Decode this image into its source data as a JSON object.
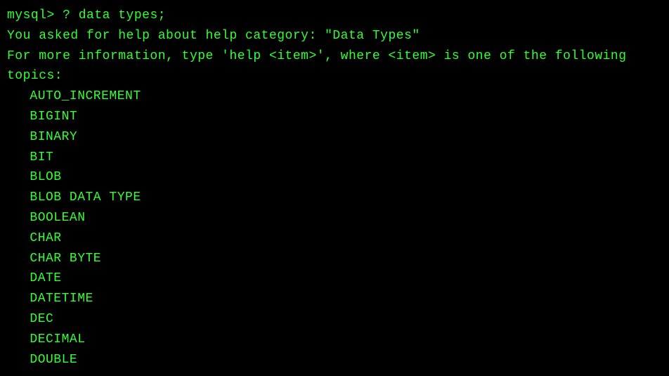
{
  "prompt": "mysql> ",
  "command": "? data types;",
  "response_line1": "You asked for help about help category: \"Data Types\"",
  "response_line2": "For more information, type 'help <item>', where <item> is one of the following",
  "response_line3": "topics:",
  "topics": [
    "AUTO_INCREMENT",
    "BIGINT",
    "BINARY",
    "BIT",
    "BLOB",
    "BLOB DATA TYPE",
    "BOOLEAN",
    "CHAR",
    "CHAR BYTE",
    "DATE",
    "DATETIME",
    "DEC",
    "DECIMAL",
    "DOUBLE"
  ]
}
